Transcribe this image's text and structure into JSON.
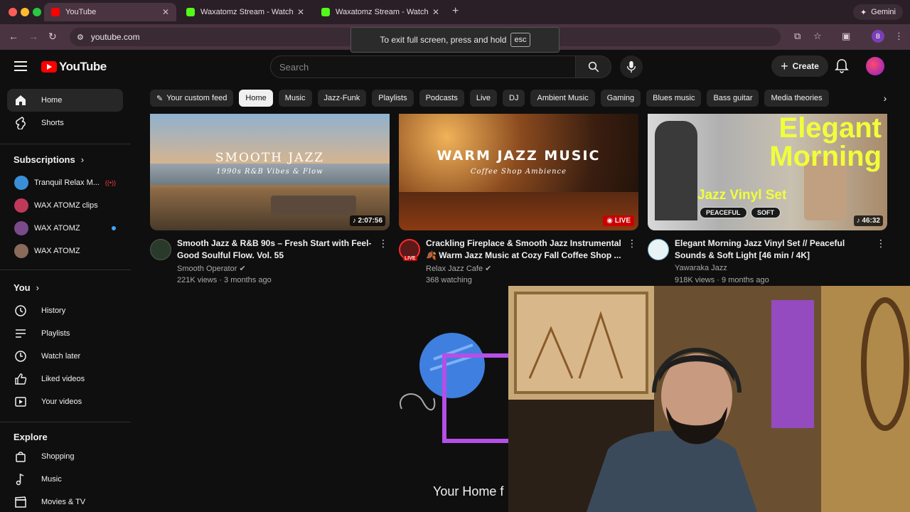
{
  "browser": {
    "tabs": [
      {
        "title": "YouTube",
        "active": true
      },
      {
        "title": "Waxatomz Stream - Watch Li",
        "active": false
      },
      {
        "title": "Waxatomz Stream - Watch Li",
        "active": false
      }
    ],
    "new_tab": "+",
    "gemini_label": "Gemini",
    "url": "youtube.com",
    "profile_initial": "B",
    "fullscreen_msg": "To exit full screen, press and hold",
    "fullscreen_key": "esc"
  },
  "header": {
    "logo_text": "YouTube",
    "search_placeholder": "Search",
    "create_label": "Create"
  },
  "sidebar": {
    "main": [
      {
        "label": "Home",
        "icon": "home-icon",
        "active": true
      },
      {
        "label": "Shorts",
        "icon": "shorts-icon",
        "active": false
      }
    ],
    "subscriptions_heading": "Subscriptions",
    "subscriptions": [
      {
        "name": "Tranquil Relax M...",
        "color": "#3a8fd6"
      },
      {
        "name": "WAX ATOMZ clips",
        "color": "#c0395a"
      },
      {
        "name": "WAX ATOMZ",
        "color": "#7a4a8a"
      },
      {
        "name": "WAX ATOMZ",
        "color": "#8a6a5a"
      }
    ],
    "you_heading": "You",
    "you_items": [
      {
        "label": "History",
        "icon": "history-icon"
      },
      {
        "label": "Playlists",
        "icon": "playlists-icon"
      },
      {
        "label": "Watch later",
        "icon": "clock-icon"
      },
      {
        "label": "Liked videos",
        "icon": "thumbs-up-icon"
      },
      {
        "label": "Your videos",
        "icon": "your-videos-icon"
      }
    ],
    "explore_heading": "Explore",
    "explore_items": [
      {
        "label": "Shopping",
        "icon": "shopping-bag-icon"
      },
      {
        "label": "Music",
        "icon": "music-note-icon"
      },
      {
        "label": "Movies & TV",
        "icon": "clapperboard-icon"
      }
    ]
  },
  "chips": [
    "Your custom feed",
    "Home",
    "Music",
    "Jazz-Funk",
    "Playlists",
    "Podcasts",
    "Live",
    "DJ",
    "Ambient Music",
    "Gaming",
    "Blues music",
    "Bass guitar",
    "Media theories"
  ],
  "videos": [
    {
      "thumb_title": "SMOOTH JAZZ",
      "thumb_sub": "1990s R&B Vibes & Flow",
      "badge": "2:07:56",
      "title": "Smooth Jazz & R&B 90s – Fresh Start with Feel-Good Soulful Flow. Vol. 55",
      "channel": "Smooth Operator",
      "stats": "221K views · 3 months ago"
    },
    {
      "thumb_title": "WARM JAZZ MUSIC",
      "thumb_sub": "Coffee Shop Ambience",
      "badge": "LIVE",
      "title": "Crackling Fireplace & Smooth Jazz Instrumental 🍂 Warm Jazz Music at Cozy Fall Coffee Shop ...",
      "channel": "Relax Jazz Cafe",
      "stats": "368 watching",
      "avatar_badge": "LIVE"
    },
    {
      "thumb_title": "Elegant Morning",
      "thumb_sub": "Jazz Vinyl Set",
      "thumb_tags": [
        "PEACEFUL",
        "SOFT"
      ],
      "badge": "46:32",
      "title": "Elegant Morning Jazz Vinyl Set // Peaceful Sounds & Soft Light [46 min / 4K]",
      "channel": "Yawaraka Jazz",
      "stats": "918K views · 9 months ago"
    }
  ],
  "empty_state_title": "Your Home f"
}
